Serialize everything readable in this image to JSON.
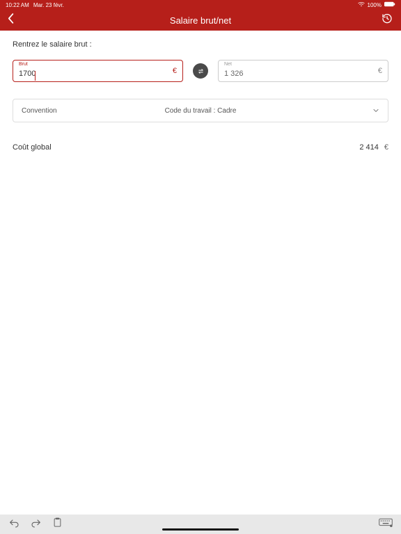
{
  "status": {
    "time": "10:22 AM",
    "date": "Mar. 23 févr.",
    "battery_pct": "100%"
  },
  "nav": {
    "title": "Salaire brut/net"
  },
  "page": {
    "subtitle": "Rentrez le salaire brut :"
  },
  "fields": {
    "brut": {
      "label": "Brut",
      "value": "1700"
    },
    "net": {
      "label": "Net",
      "value": "1 326"
    }
  },
  "dropdown": {
    "label": "Convention",
    "value": "Code du travail : Cadre"
  },
  "cost": {
    "label": "Coût global",
    "value": "2 414",
    "currency": "€"
  },
  "currency": "€"
}
